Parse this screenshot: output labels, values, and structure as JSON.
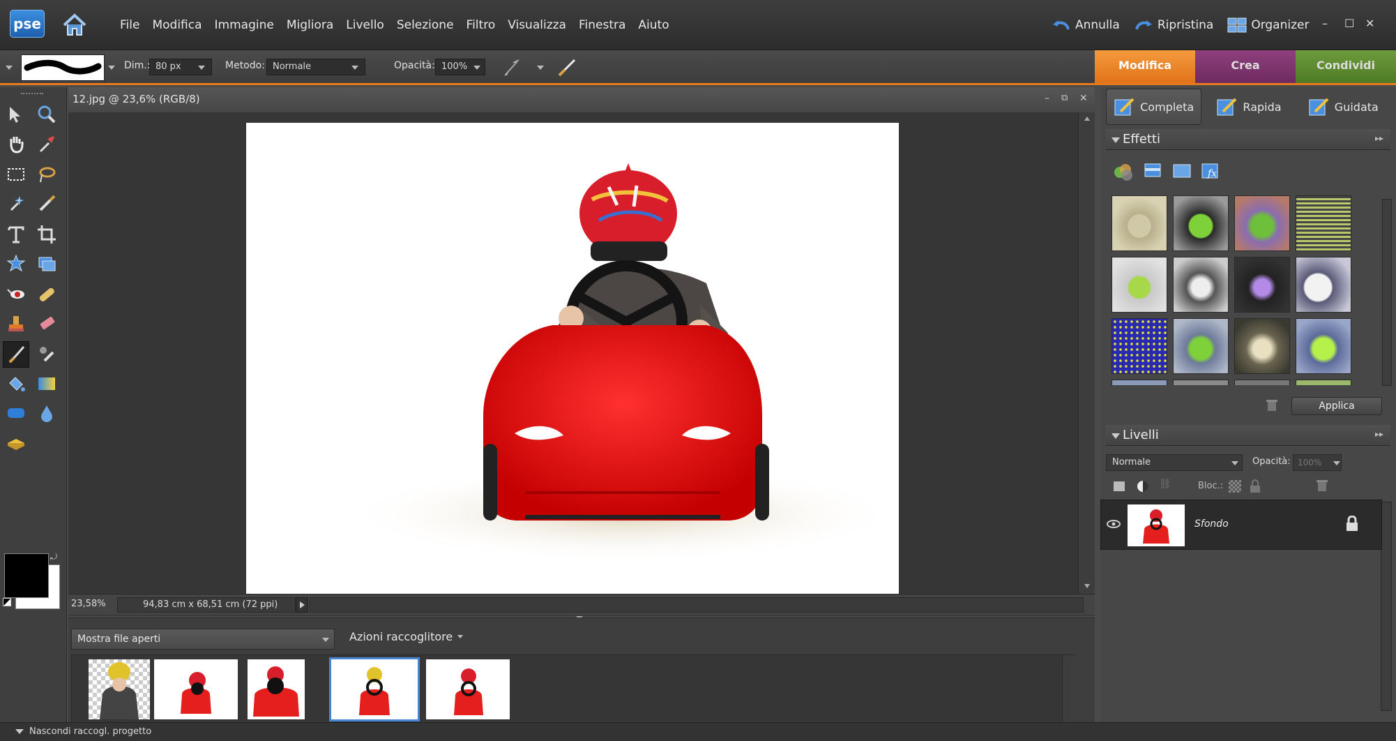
{
  "app": {
    "logo": "pse",
    "home": "home-icon"
  },
  "menu": [
    "File",
    "Modifica",
    "Immagine",
    "Migliora",
    "Livello",
    "Selezione",
    "Filtro",
    "Visualizza",
    "Finestra",
    "Aiuto"
  ],
  "commands": {
    "undo": "Annulla",
    "redo": "Ripristina",
    "organizer": "Organizer"
  },
  "options": {
    "size_label": "Dim.:",
    "size_value": "80 px",
    "mode_label": "Metodo:",
    "mode_value": "Normale",
    "opacity_label": "Opacità:",
    "opacity_value": "100%"
  },
  "mode_tabs": [
    "Modifica",
    "Crea",
    "Condividi"
  ],
  "edit_tabs": [
    "Completa",
    "Rapida",
    "Guidata"
  ],
  "document": {
    "title": "12.jpg @ 23,6% (RGB/8)",
    "zoom": "23,58%",
    "dimensions": "94,83 cm x 68,51 cm (72 ppi)"
  },
  "bin": {
    "show_label": "Mostra file aperti",
    "actions_label": "Azioni raccoglitore",
    "hide_label": "Nascondi raccogl. progetto",
    "selected_index": 3
  },
  "effects": {
    "title": "Effetti",
    "apply": "Applica"
  },
  "layers": {
    "title": "Livelli",
    "blend": "Normale",
    "opacity_label": "Opacità:",
    "opacity_value": "100%",
    "lock_label": "Bloc.:",
    "items": [
      {
        "name": "Sfondo",
        "visible": true,
        "locked": true
      }
    ]
  },
  "colors": {
    "accent": "#e87a1d",
    "foreground": "#000000",
    "background": "#ffffff"
  }
}
